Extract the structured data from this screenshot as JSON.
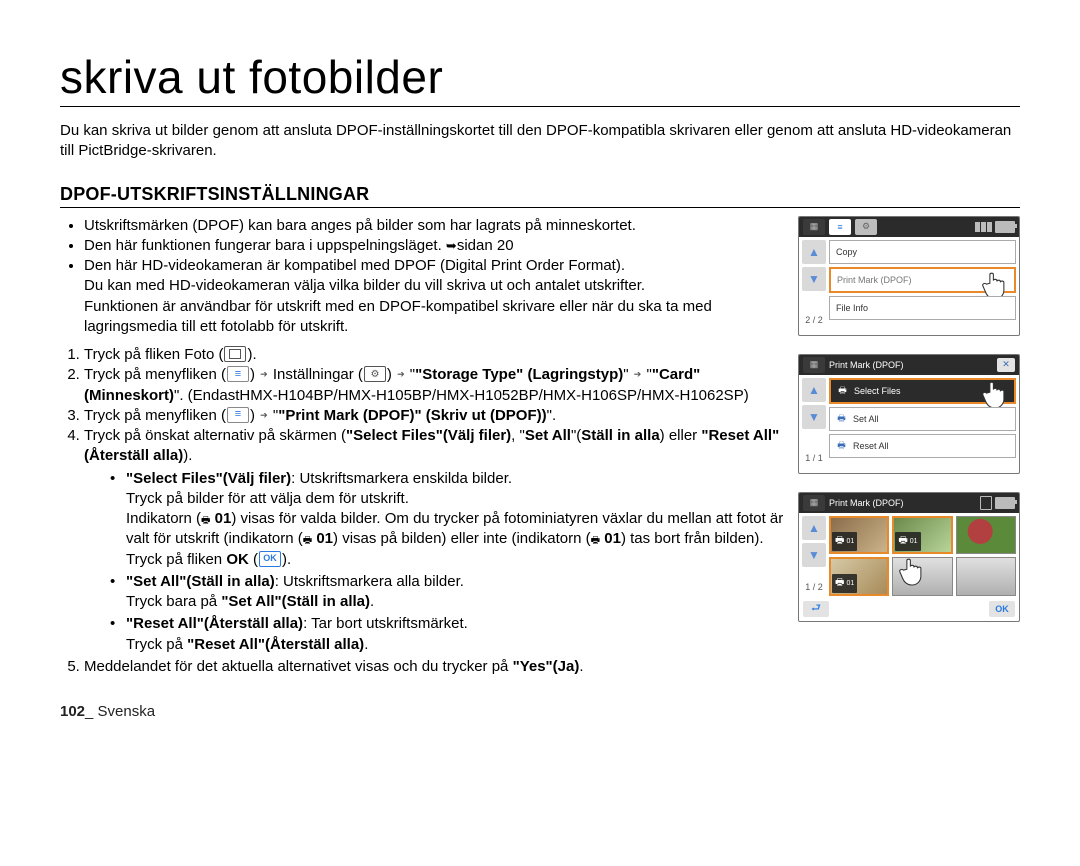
{
  "title": "skriva ut fotobilder",
  "intro": "Du kan skriva ut bilder genom att ansluta DPOF-inställningskortet till den DPOF-kompatibla skrivaren eller genom att ansluta HD-videokameran till PictBridge-skrivaren.",
  "section_heading": "DPOF-UTSKRIFTSINSTÄLLNINGAR",
  "bullets": [
    "Utskriftsmärken (DPOF) kan bara anges på bilder som har lagrats på minneskortet.",
    "Den här funktionen fungerar bara i uppspelningsläget. ",
    "Den här HD-videokameran är kompatibel med DPOF (Digital Print Order Format).\nDu kan med HD-videokameran välja vilka bilder du vill skriva ut och antalet utskrifter.\nFunktionen är användbar för utskrift med en DPOF-kompatibel skrivare eller när du ska ta med lagringsmedia till ett fotolabb för utskrift."
  ],
  "page_ref": "sidan 20",
  "steps": {
    "s1_a": "Tryck på fliken Foto (",
    "s1_b": ").",
    "s2_a": "Tryck på menyfliken (",
    "s2_b": ") ",
    "s2_c": " Inställningar (",
    "s2_d": ") ",
    "s2_e_bold": "\"Storage Type\" (Lagringstyp)",
    "s2_f": " ",
    "s2_g_bold": "\"Card\" (Minneskort)",
    "s2_h": ". (EndastHMX-H104BP/HMX-H105BP/HMX-H1052BP/HMX-H106SP/HMX-H1062SP)",
    "s3_a": "Tryck på menyfliken (",
    "s3_b": ") ",
    "s3_c_bold": "\"Print Mark (DPOF)\" (Skriv ut (DPOF))",
    "s3_d": ".",
    "s4_a": "Tryck på önskat alternativ på skärmen (",
    "s4_b_bold": "\"Select Files\"(Välj filer)",
    "s4_c": ", \"",
    "s4_d_bold": "Set All",
    "s4_e": "\"(",
    "s4_f_bold": "Ställ in alla",
    "s4_g": ") eller ",
    "s4_h_bold": "\"Reset All\"(Återställ alla)",
    "s4_i": ").",
    "sub_sel_head_bold": "\"Select Files\"(Välj filer)",
    "sub_sel_head_rest": ": Utskriftsmarkera enskilda bilder.",
    "sub_sel_l2": "Tryck på bilder för att välja dem för utskrift.",
    "sub_sel_l3a": "Indikatorn (",
    "sub_sel_l3b_bold": " 01",
    "sub_sel_l3c": ") visas för valda bilder. Om du trycker på fotominiatyren växlar du mellan att fotot är valt för utskrift (indikatorn (",
    "sub_sel_l3d_bold": " 01",
    "sub_sel_l3e": ") visas på bilden) eller inte (indikatorn (",
    "sub_sel_l3f_bold": " 01",
    "sub_sel_l3g": ") tas bort från bilden). Tryck på fliken ",
    "sub_sel_l3h_bold": "OK",
    "sub_sel_l3i": " (",
    "sub_sel_l3j": ").",
    "sub_set_head_bold": "\"Set All\"(Ställ in alla)",
    "sub_set_head_rest": ": Utskriftsmarkera alla bilder.",
    "sub_set_l2a": "Tryck bara på ",
    "sub_set_l2b_bold": "\"Set All\"(Ställ in alla)",
    "sub_set_l2c": ".",
    "sub_reset_head_bold": "\"Reset All\"(Återställ alla)",
    "sub_reset_head_rest": ": Tar bort utskriftsmärket.",
    "sub_reset_l2a": "Tryck på ",
    "sub_reset_l2b_bold": "\"Reset All\"(Återställ alla)",
    "sub_reset_l2c": ".",
    "s5_a": "Meddelandet för det aktuella alternativet visas och du trycker på ",
    "s5_b_bold": "\"Yes\"(Ja)",
    "s5_c": "."
  },
  "screens": {
    "s1": {
      "page": "2 / 2",
      "items": [
        "Copy",
        "Print Mark (DPOF)",
        "File Info"
      ]
    },
    "s2": {
      "title": "Print Mark (DPOF)",
      "page": "1 / 1",
      "items": [
        "Select Files",
        "Set All",
        "Reset All"
      ]
    },
    "s3": {
      "title": "Print Mark (DPOF)",
      "page": "1 / 2",
      "badge": "01",
      "ok": "OK"
    }
  },
  "ok_text": "OK",
  "footer_page": "102",
  "footer_lang": "_ Svenska"
}
